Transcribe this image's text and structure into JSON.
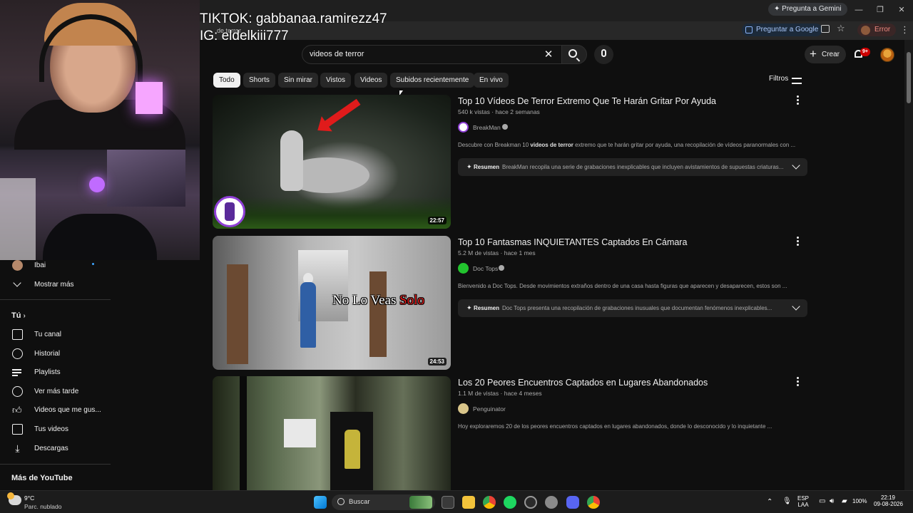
{
  "browser": {
    "gemini_button": "Pregunta a Gemini",
    "ask_google": "Preguntar a Google",
    "profile_status": "Error",
    "tab_fragment": "de terror"
  },
  "overlay": {
    "tiktok": "TIKTOK: gabbanaa.ramirezz47",
    "instagram": "IG: eldelkiii777"
  },
  "header": {
    "search_value": "videos de terror",
    "create_label": "Crear",
    "notifications_badge": "9+"
  },
  "chips": [
    "Todo",
    "Shorts",
    "Sin mirar",
    "Vistos",
    "Videos",
    "Subidos recientemente",
    "En vivo"
  ],
  "active_chip": "Todo",
  "filters_label": "Filtros",
  "sidebar": {
    "subscription": "Ibai",
    "show_more": "Mostrar más",
    "you_header": "Tú",
    "you_items": [
      "Tu canal",
      "Historial",
      "Playlists",
      "Ver más tarde",
      "Videos que me gus...",
      "Tus videos",
      "Descargas"
    ],
    "more_header": "Más de YouTube"
  },
  "results": [
    {
      "title": "Top 10 Vídeos De Terror Extremo Que Te Harán Gritar Por Ayuda",
      "meta": "540 k vistas · hace 2 semanas",
      "channel": "BreakMan",
      "desc_pre": "Descubre con Breakman 10 ",
      "desc_bold": "videos de terror",
      "desc_post": " extremo que te harán gritar por ayuda, una recopilación de vídeos paranormales con ...",
      "summary_label": "Resumen",
      "summary_text": "BreakMan recopila una serie de grabaciones inexplicables que incluyen avistamientos de supuestas criaturas...",
      "duration": "22:57"
    },
    {
      "title": "Top 10 Fantasmas INQUIETANTES Captados En Cámara",
      "meta": "5.2 M de vistas · hace 1 mes",
      "channel": "Doc Tops",
      "desc_pre": "Bienvenido a Doc Tops. Desde movimientos extraños dentro de una casa hasta figuras que aparecen y desaparecen, estos son ...",
      "desc_bold": "",
      "desc_post": "",
      "summary_label": "Resumen",
      "summary_text": "Doc Tops presenta una recopilación de grabaciones inusuales que documentan fenómenos inexplicables...",
      "duration": "24:53",
      "thumb_caption_a": "No Lo Veas ",
      "thumb_caption_b": "Solo"
    },
    {
      "title": "Los 20 Peores Encuentros Captados en Lugares Abandonados",
      "meta": "1.1 M de vistas · hace 4 meses",
      "channel": "Penguinator",
      "desc_pre": "Hoy exploraremos 20 de los peores encuentros captados en lugares abandonados, donde lo desconocido y lo inquietante ...",
      "desc_bold": "",
      "desc_post": ""
    }
  ],
  "taskbar": {
    "temperature": "9°C",
    "condition": "Parc. nublado",
    "search_label": "Buscar",
    "lang_top": "ESP",
    "lang_bottom": "LAA",
    "battery": "100%",
    "time": "22:19",
    "date": "09-08-2026"
  },
  "colors": {
    "background": "#0f0f0f",
    "chip": "#272727",
    "text": "#f1f1f1",
    "secondary_text": "#aaaaaa",
    "notification_red": "#cc0000"
  }
}
